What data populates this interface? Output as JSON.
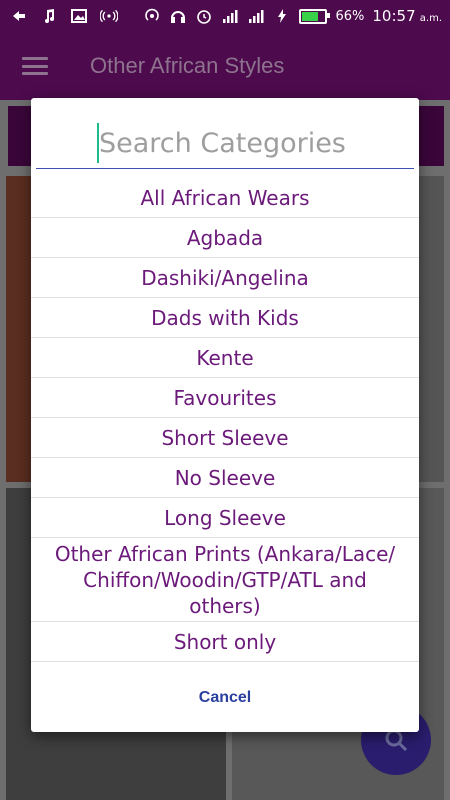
{
  "statusbar": {
    "battery_percent": "66%",
    "battery_level": 0.66,
    "time": "10:57",
    "ampm": "a.m.",
    "icons": [
      "back-arrow-icon",
      "music-icon",
      "image-icon",
      "broadcast-icon",
      "hotspot-icon",
      "headset-icon",
      "alarm-icon",
      "signal-icon",
      "signal-icon",
      "charging-icon",
      "battery-icon"
    ]
  },
  "appbar": {
    "title": "Other African Styles"
  },
  "dialog": {
    "search_placeholder": "Search Categories",
    "categories": [
      "All African Wears",
      "Agbada",
      "Dashiki/Angelina",
      "Dads with Kids",
      "Kente",
      "Favourites",
      "Short Sleeve",
      "No Sleeve",
      "Long Sleeve",
      "Other African Prints (Ankara/Lace/ Chiffon/Woodin/GTP/ATL and others)",
      "Short only"
    ],
    "cancel_label": "Cancel"
  },
  "colors": {
    "primary": "#4d0a4d",
    "item_text": "#6b1a7a",
    "accent": "#3f51b5",
    "cursor": "#1bbc8a"
  }
}
